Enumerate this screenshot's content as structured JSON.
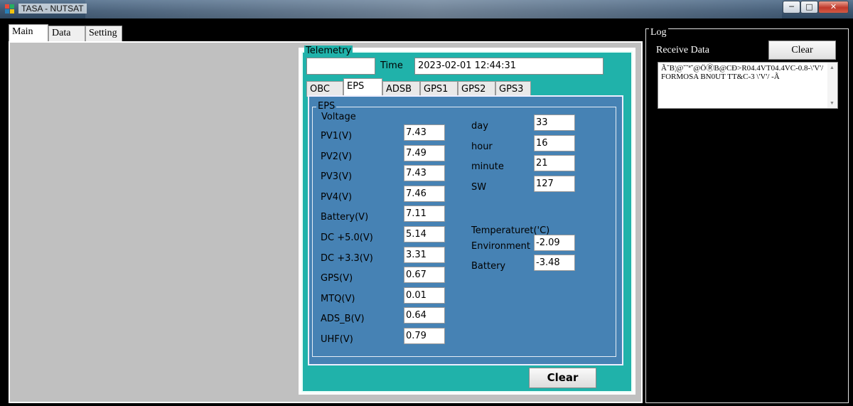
{
  "window": {
    "title": "TASA - NUTSAT",
    "minimize": "─",
    "maximize": "□",
    "close": "✕"
  },
  "main_tabs": [
    {
      "label": "Main"
    },
    {
      "label": "Data"
    },
    {
      "label": "Setting"
    }
  ],
  "telemetry": {
    "legend": "Telemetry",
    "id_value": "",
    "time_label": "Time",
    "time_value": "2023-02-01 12:44:31",
    "tabs": [
      {
        "label": "OBC"
      },
      {
        "label": "EPS"
      },
      {
        "label": "ADSB"
      },
      {
        "label": "GPS1"
      },
      {
        "label": "GPS2"
      },
      {
        "label": "GPS3"
      }
    ],
    "active_tab": "EPS",
    "clear_label": "Clear"
  },
  "eps": {
    "legend": "EPS",
    "voltage_heading": "Voltage",
    "voltages": [
      {
        "label": "PV1(V)",
        "value": "7.43"
      },
      {
        "label": "PV2(V)",
        "value": "7.49"
      },
      {
        "label": "PV3(V)",
        "value": "7.43"
      },
      {
        "label": "PV4(V)",
        "value": "7.46"
      },
      {
        "label": "Battery(V)",
        "value": "7.11"
      },
      {
        "label": "DC +5.0(V)",
        "value": "5.14"
      },
      {
        "label": "DC +3.3(V)",
        "value": "3.31"
      },
      {
        "label": "GPS(V)",
        "value": "0.67"
      },
      {
        "label": "MTQ(V)",
        "value": "0.01"
      },
      {
        "label": "ADS_B(V)",
        "value": "0.64"
      },
      {
        "label": "UHF(V)",
        "value": "0.79"
      }
    ],
    "time_fields": [
      {
        "label": "day",
        "value": "33"
      },
      {
        "label": "hour",
        "value": "16"
      },
      {
        "label": "minute",
        "value": "21"
      },
      {
        "label": "SW",
        "value": "127"
      }
    ],
    "temperature_heading": "Temperaturet('C)",
    "temperatures": [
      {
        "label": "Environment",
        "value": "-2.09"
      },
      {
        "label": "Battery",
        "value": "-3.48"
      }
    ]
  },
  "log": {
    "legend": "Log",
    "receive_label": "Receive Data",
    "clear_label": "Clear",
    "received_text": "Ã˘B¦@˘˘ª˘@ÖⓇB@CĐ>R04.4VT04.4VC-0.8-\\'V'/ FORMOSA BN0UT TT&C-3 \\'V'/ -Ã"
  },
  "colors": {
    "telemetry_bg": "#20b2aa",
    "eps_bg": "#4682b4",
    "main_bg": "#c0c0c0",
    "log_bg": "#000000"
  }
}
